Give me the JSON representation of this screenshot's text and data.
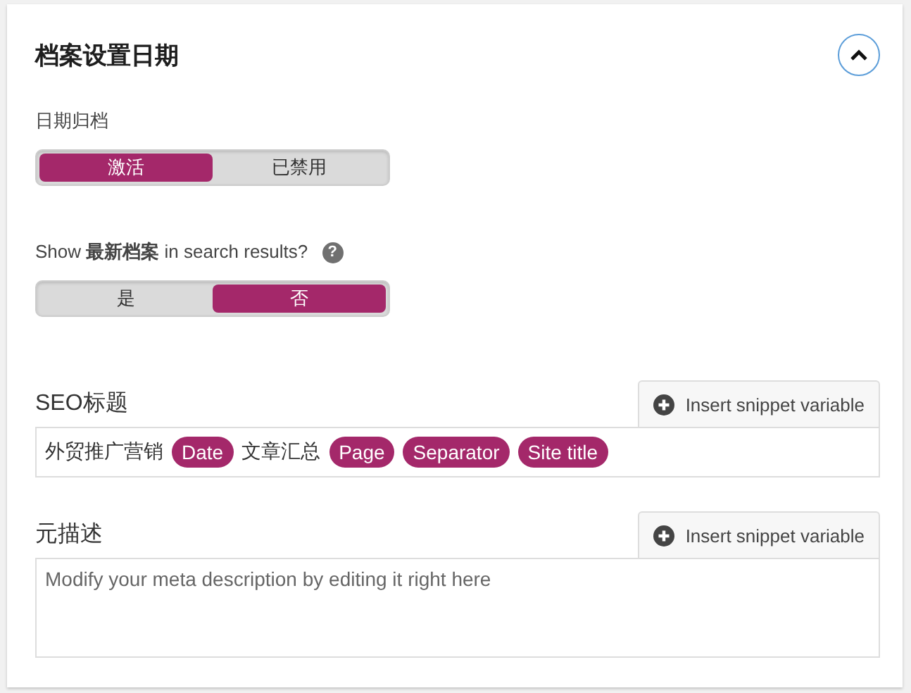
{
  "section": {
    "title": "档案设置日期",
    "expanded": true
  },
  "date_archives": {
    "label": "日期归档",
    "options": [
      {
        "label": "激活",
        "selected": true
      },
      {
        "label": "已禁用",
        "selected": false
      }
    ]
  },
  "search_results": {
    "label": "Show **最新档案** in search results?",
    "help": "?",
    "options": [
      {
        "label": "是",
        "selected": false
      },
      {
        "label": "否",
        "selected": true
      }
    ]
  },
  "seo_title": {
    "label": "SEO标题",
    "button": "Insert snippet variable",
    "parts": [
      {
        "kind": "text",
        "text": "外贸推广营销"
      },
      {
        "kind": "variable",
        "text": "Date"
      },
      {
        "kind": "text",
        "text": "文章汇总"
      },
      {
        "kind": "variable",
        "text": "Page"
      },
      {
        "kind": "variable",
        "text": "Separator"
      },
      {
        "kind": "variable",
        "text": "Site title"
      }
    ]
  },
  "meta_description": {
    "label": "元描述",
    "button": "Insert snippet variable",
    "placeholder": "Modify your meta description by editing it right here"
  }
}
